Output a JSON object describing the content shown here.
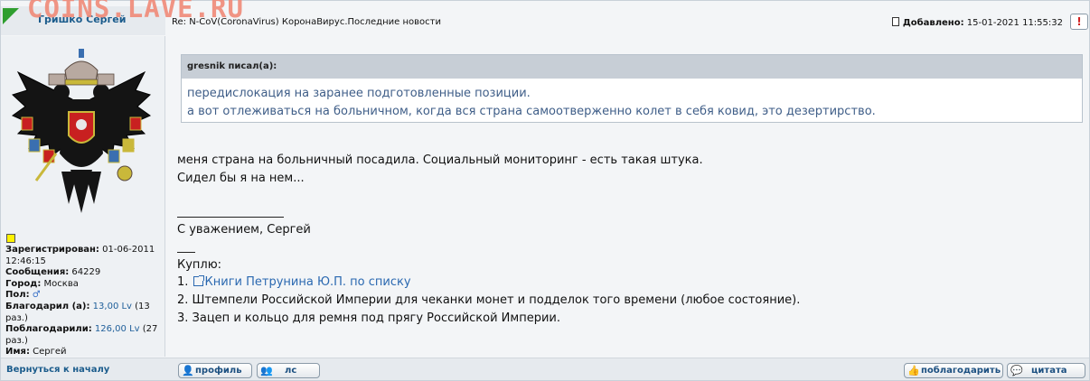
{
  "watermark": "COINS.LAVE.RU",
  "author": {
    "name": "Гришко Сергей",
    "registered_label": "Зарегистрирован:",
    "registered_value": "01-06-2011 12:46:15",
    "messages_label": "Сообщения:",
    "messages_value": "64229",
    "city_label": "Город:",
    "city_value": "Москва",
    "gender_label": "Пол:",
    "gender_icon": "male-icon",
    "thanked_label": "Благодарил (а):",
    "thanked_value": "13,00 Lv",
    "thanked_times": "(13 раз.)",
    "was_thanked_label": "Поблагодарили:",
    "was_thanked_value": "126,00 Lv",
    "was_thanked_times": "(27 раз.)",
    "name_label": "Имя:",
    "name_value": "Сергей"
  },
  "post": {
    "subject": "Re: N-CoV(CoronaVirus) КоронаВирус.Последние новости",
    "added_label": "Добавлено:",
    "added_value": "15-01-2021 11:55:32",
    "report_label": "!",
    "quote_author": "gresnik писал(а):",
    "quote_lines": [
      "передислокация на заранее подготовленные позиции.",
      "а вот отлеживаться на больничном, когда вся страна самоотверженно колет в себя ковид, это дезертирство."
    ],
    "body_lines": [
      "меня страна на больничный посадила. Социальный мониторинг - есть такая штука.",
      "Сидел бы я на нем..."
    ],
    "signature": "С уважением, Сергей",
    "buy_title": "Куплю:",
    "buy_items": [
      {
        "num": "1.",
        "text": "Книги Петрунина Ю.П. по списку"
      },
      {
        "num": "",
        "text": "2. Штемпели Российской Империи для чеканки монет и подделок того времени (любое состояние)."
      },
      {
        "num": "",
        "text": "3. Зацеп и кольцо для ремня под прягу Российской Империи."
      }
    ]
  },
  "footer": {
    "back_to_top": "Вернуться к началу",
    "profile_btn": "профиль",
    "pm_btn": "лс",
    "thank_btn": "поблагодарить",
    "quote_btn": "цитата"
  },
  "colors": {
    "accent_blue": "#1b5c8c",
    "quote_text": "#3f5e88",
    "link": "#2a68b0",
    "status_online": "#fff200"
  }
}
